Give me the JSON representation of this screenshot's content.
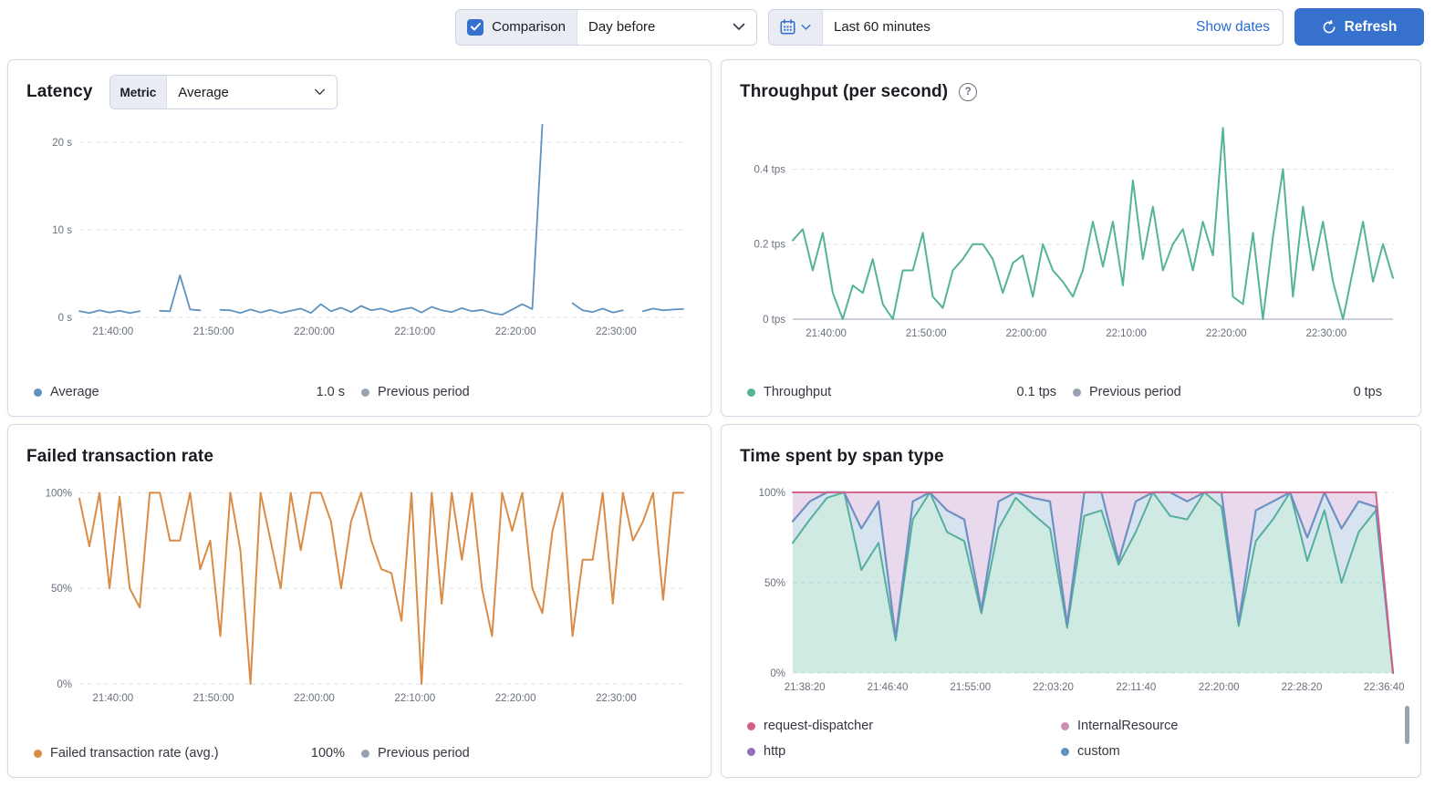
{
  "topbar": {
    "comparison_label": "Comparison",
    "comparison_value": "Day before",
    "time_range": "Last 60 minutes",
    "show_dates": "Show dates",
    "refresh_label": "Refresh",
    "accent_color": "#3671cd"
  },
  "panels": {
    "latency": {
      "title": "Latency",
      "metric_label": "Metric",
      "metric_value": "Average",
      "legend": [
        {
          "label": "Average",
          "value": "1.0 s",
          "color": "#6092C0"
        },
        {
          "label": "Previous period",
          "value": "",
          "color": "#98A2B3"
        }
      ]
    },
    "throughput": {
      "title": "Throughput (per second)",
      "help_icon": "?",
      "legend": [
        {
          "label": "Throughput",
          "value": "0.1 tps",
          "color": "#54B399"
        },
        {
          "label": "Previous period",
          "value": "0 tps",
          "color": "#98A2B3"
        }
      ]
    },
    "failed": {
      "title": "Failed transaction rate",
      "legend": [
        {
          "label": "Failed transaction rate (avg.)",
          "value": "100%",
          "color": "#DA8B45"
        },
        {
          "label": "Previous period",
          "value": "",
          "color": "#98A2B3"
        }
      ]
    },
    "span": {
      "title": "Time spent by span type",
      "legend": [
        {
          "label": "request-dispatcher",
          "color": "#D36086"
        },
        {
          "label": "InternalResource",
          "color": "#CA8EAE"
        },
        {
          "label": "http",
          "color": "#9170B8"
        },
        {
          "label": "custom",
          "color": "#6092C0"
        }
      ]
    }
  },
  "chart_data": [
    {
      "type": "line",
      "title": "Latency",
      "ylabel": "seconds",
      "ylim": [
        0,
        22.5
      ],
      "grid": true,
      "baseline": false,
      "yticks": [
        {
          "v": 20,
          "label": "20 s"
        },
        {
          "v": 10,
          "label": "10 s"
        },
        {
          "v": 0,
          "label": "0 s"
        }
      ],
      "xticks": [
        {
          "f": 0.0556,
          "label": "21:40:00"
        },
        {
          "f": 0.2222,
          "label": "21:50:00"
        },
        {
          "f": 0.3889,
          "label": "22:00:00"
        },
        {
          "f": 0.5556,
          "label": "22:10:00"
        },
        {
          "f": 0.7222,
          "label": "22:20:00"
        },
        {
          "f": 0.8889,
          "label": "22:30:00"
        }
      ],
      "series": [
        {
          "name": "Average",
          "color": "#6092C0",
          "width": 1.8,
          "values": [
            0.7,
            0.5,
            0.8,
            0.55,
            0.75,
            0.5,
            0.7,
            null,
            0.75,
            0.7,
            4.8,
            0.9,
            0.8,
            null,
            0.85,
            0.8,
            0.5,
            0.9,
            0.55,
            0.85,
            0.5,
            0.75,
            1.0,
            0.5,
            1.5,
            0.7,
            1.1,
            0.6,
            1.3,
            0.8,
            1.0,
            0.6,
            0.9,
            1.1,
            0.55,
            1.2,
            0.8,
            0.6,
            1.05,
            0.7,
            0.85,
            0.5,
            0.3,
            0.9,
            1.5,
            0.95,
            22.0,
            null,
            null,
            1.6,
            0.8,
            0.6,
            1.0,
            0.55,
            0.8,
            null,
            0.7,
            1.0,
            0.8,
            0.9,
            0.95
          ]
        }
      ]
    },
    {
      "type": "line",
      "title": "Throughput (per second)",
      "ylabel": "tps",
      "ylim": [
        0,
        0.53
      ],
      "grid": true,
      "baseline": true,
      "yticks": [
        {
          "v": 0.4,
          "label": "0.4 tps"
        },
        {
          "v": 0.2,
          "label": "0.2 tps"
        },
        {
          "v": 0,
          "label": "0 tps"
        }
      ],
      "xticks": [
        {
          "f": 0.0556,
          "label": "21:40:00"
        },
        {
          "f": 0.2222,
          "label": "21:50:00"
        },
        {
          "f": 0.3889,
          "label": "22:00:00"
        },
        {
          "f": 0.5556,
          "label": "22:10:00"
        },
        {
          "f": 0.7222,
          "label": "22:20:00"
        },
        {
          "f": 0.8889,
          "label": "22:30:00"
        }
      ],
      "series": [
        {
          "name": "Throughput",
          "color": "#54B399",
          "width": 2,
          "values": [
            0.21,
            0.24,
            0.13,
            0.23,
            0.07,
            0.0,
            0.09,
            0.07,
            0.16,
            0.04,
            0.0,
            0.13,
            0.13,
            0.23,
            0.06,
            0.03,
            0.13,
            0.16,
            0.2,
            0.2,
            0.16,
            0.07,
            0.15,
            0.17,
            0.06,
            0.2,
            0.13,
            0.1,
            0.06,
            0.13,
            0.26,
            0.14,
            0.26,
            0.09,
            0.37,
            0.16,
            0.3,
            0.13,
            0.2,
            0.24,
            0.13,
            0.26,
            0.17,
            0.51,
            0.06,
            0.04,
            0.23,
            0.0,
            0.22,
            0.4,
            0.06,
            0.3,
            0.13,
            0.26,
            0.1,
            0.0,
            0.13,
            0.26,
            0.1,
            0.2,
            0.11
          ]
        }
      ]
    },
    {
      "type": "line",
      "title": "Failed transaction rate",
      "ylabel": "percent",
      "ylim": [
        0,
        104
      ],
      "grid": true,
      "baseline": false,
      "yticks": [
        {
          "v": 100,
          "label": "100%"
        },
        {
          "v": 50,
          "label": "50%"
        },
        {
          "v": 0,
          "label": "0%"
        }
      ],
      "xticks": [
        {
          "f": 0.0556,
          "label": "21:40:00"
        },
        {
          "f": 0.2222,
          "label": "21:50:00"
        },
        {
          "f": 0.3889,
          "label": "22:00:00"
        },
        {
          "f": 0.5556,
          "label": "22:10:00"
        },
        {
          "f": 0.7222,
          "label": "22:20:00"
        },
        {
          "f": 0.8889,
          "label": "22:30:00"
        }
      ],
      "series": [
        {
          "name": "Failed transaction rate (avg.)",
          "color": "#DA8B45",
          "width": 2,
          "values": [
            97,
            72,
            100,
            50,
            98,
            50,
            40,
            100,
            100,
            75,
            75,
            100,
            60,
            75,
            25,
            100,
            70,
            0,
            100,
            75,
            50,
            100,
            70,
            100,
            100,
            85,
            50,
            85,
            100,
            75,
            60,
            58,
            33,
            100,
            0,
            100,
            42,
            100,
            65,
            100,
            50,
            25,
            100,
            80,
            100,
            50,
            37,
            80,
            100,
            25,
            65,
            65,
            100,
            42,
            100,
            75,
            85,
            100,
            44,
            100,
            100
          ]
        }
      ]
    },
    {
      "type": "area",
      "title": "Time spent by span type",
      "ylabel": "percent",
      "ylim": [
        0,
        104
      ],
      "grid": true,
      "baseline": false,
      "yticks": [
        {
          "v": 100,
          "label": "100%"
        },
        {
          "v": 50,
          "label": "50%"
        },
        {
          "v": 0,
          "label": "0%"
        }
      ],
      "xticks": [
        {
          "f": 0.02,
          "label": "21:38:20"
        },
        {
          "f": 0.158,
          "label": "21:46:40"
        },
        {
          "f": 0.296,
          "label": "21:55:00"
        },
        {
          "f": 0.434,
          "label": "22:03:20"
        },
        {
          "f": 0.572,
          "label": "22:11:40"
        },
        {
          "f": 0.71,
          "label": "22:20:00"
        },
        {
          "f": 0.848,
          "label": "22:28:20"
        },
        {
          "f": 0.985,
          "label": "22:36:40"
        }
      ],
      "series": [
        {
          "name": "bottom-band-green",
          "color": "#54B399",
          "width": 2,
          "fill": "rgba(84,179,153,0.28)",
          "fillTo": "zero",
          "values": [
            72,
            85,
            97,
            100,
            57,
            72,
            18,
            85,
            100,
            78,
            73,
            33,
            80,
            97,
            88,
            80,
            25,
            87,
            90,
            60,
            78,
            100,
            87,
            85,
            100,
            92,
            26,
            73,
            85,
            100,
            62,
            90,
            50,
            78,
            90,
            0
          ]
        },
        {
          "name": "middle-band-custom-blue",
          "color": "#6092C0",
          "width": 2.2,
          "fill": "rgba(96,146,192,0.25)",
          "fillTo": "prev",
          "values": [
            84,
            95,
            100,
            100,
            80,
            95,
            20,
            95,
            100,
            90,
            85,
            35,
            95,
            100,
            97,
            95,
            27,
            100,
            100,
            62,
            95,
            100,
            100,
            95,
            100,
            100,
            28,
            90,
            95,
            100,
            75,
            100,
            80,
            95,
            92,
            0
          ]
        },
        {
          "name": "top-band-request-dispatcher-red",
          "color": "#D36086",
          "width": 2,
          "fill": "rgba(185,140,196,0.32)",
          "fillTo": "prev",
          "values": [
            100,
            100,
            100,
            100,
            100,
            100,
            100,
            100,
            100,
            100,
            100,
            100,
            100,
            100,
            100,
            100,
            100,
            100,
            100,
            100,
            100,
            100,
            100,
            100,
            100,
            100,
            100,
            100,
            100,
            100,
            100,
            100,
            100,
            100,
            100,
            0
          ]
        }
      ]
    }
  ]
}
